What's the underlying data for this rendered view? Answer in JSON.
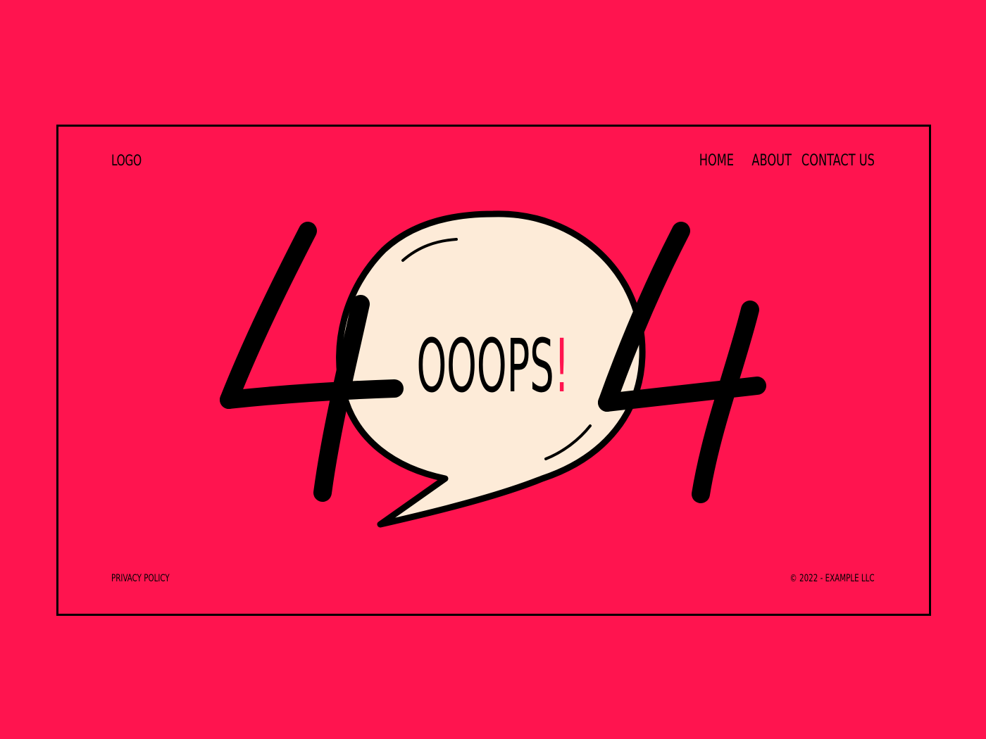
{
  "header": {
    "logo": "LOGO",
    "nav": {
      "home": "HOME",
      "about": "ABOUT",
      "contact": "CONTACT US"
    }
  },
  "hero": {
    "code_left": "4",
    "code_right": "4",
    "bubble_text": "OOOPS",
    "bubble_mark": "!"
  },
  "footer": {
    "privacy": "PRIVACY POLICY",
    "copyright": "© 2022 - EXAMPLE LLC"
  },
  "colors": {
    "background": "#ff144f",
    "bubble": "#fdebd8",
    "ink": "#000000",
    "accent": "#ff144f"
  }
}
